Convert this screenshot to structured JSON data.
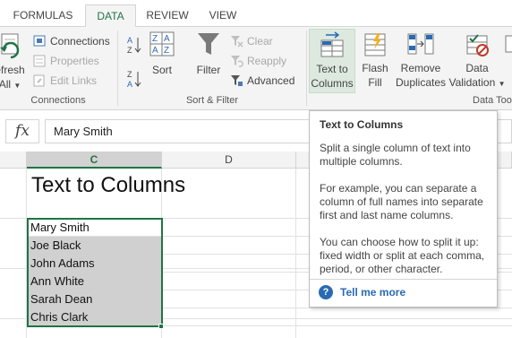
{
  "tabs": [
    {
      "label": "FORMULAS"
    },
    {
      "label": "DATA"
    },
    {
      "label": "REVIEW"
    },
    {
      "label": "VIEW"
    }
  ],
  "ribbon": {
    "refresh_label_1": "efresh",
    "refresh_label_2": "All",
    "connections": {
      "connections_label": "Connections",
      "properties_label": "Properties",
      "edit_links_label": "Edit Links",
      "group_label": "Connections"
    },
    "sort_filter": {
      "sort_label": "Sort",
      "filter_label": "Filter",
      "clear_label": "Clear",
      "reapply_label": "Reapply",
      "advanced_label": "Advanced",
      "group_label": "Sort & Filter"
    },
    "data_tools": {
      "text_to_columns_1": "Text to",
      "text_to_columns_2": "Columns",
      "flash_fill_1": "Flash",
      "flash_fill_2": "Fill",
      "remove_dup_1": "Remove",
      "remove_dup_2": "Duplicates",
      "data_val_1": "Data",
      "data_val_2": "Validation",
      "group_label": "Data Too"
    }
  },
  "formula_bar": {
    "fx_label": "fx",
    "value": "Mary Smith"
  },
  "grid": {
    "column_c": "C",
    "column_d": "D",
    "title_cell": "Text to Columns",
    "names": [
      "Mary Smith",
      "Joe Black",
      "John Adams",
      "Ann White",
      "Sarah Dean",
      "Chris Clark"
    ]
  },
  "tooltip": {
    "title": "Text to Columns",
    "p1": "Split a single column of text into multiple columns.",
    "p2": "For example, you can separate a column of full names into separate first and last name columns.",
    "p3": "You can choose how to split it up: fixed width or split at each comma, period, or other character.",
    "link": "Tell me more"
  },
  "colors": {
    "accent": "#217346",
    "link": "#2a6ab4"
  }
}
